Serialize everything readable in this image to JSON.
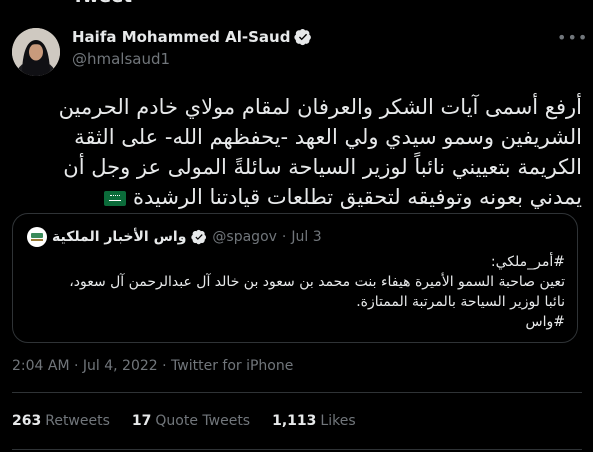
{
  "header": {
    "title": "Tweet"
  },
  "author": {
    "name": "Haifa Mohammed Al-Saud",
    "handle": "@hmalsaud1",
    "verified": true
  },
  "tweet": {
    "text": "أرفع أسمى آيات الشكر والعرفان لمقام مولاي خادم الحرمين الشريفين وسمو سيدي ولي العهد -يحفظهم الله- على الثقة الكريمة بتعييني نائباً لوزير السياحة سائلةً المولى عز وجل أن يمدني بعونه وتوفيقه لتحقيق تطلعات قيادتنا الرشيدة"
  },
  "quoted": {
    "name": "واس الأخبار الملكية",
    "handle": "@spagov",
    "separator": "·",
    "date": "Jul 3",
    "lines": [
      "#أمر_ملكي:",
      "تعين صاحبة السمو الأميرة هيفاء بنت محمد بن سعود بن خالد آل عبدالرحمن آل سعود،",
      "نائبا لوزير السياحة بالمرتبة الممتازة.",
      "#واس"
    ]
  },
  "meta": {
    "text": "2:04 AM · Jul 4, 2022 · Twitter for iPhone"
  },
  "stats": {
    "retweets_count": "263",
    "retweets_label": "Retweets",
    "quotes_count": "17",
    "quotes_label": "Quote Tweets",
    "likes_count": "1,113",
    "likes_label": "Likes"
  },
  "colors": {
    "background": "#000000",
    "text": "#e7e9ea",
    "muted": "#71767b",
    "border": "#2f3336",
    "verified": "#e7e9ea"
  }
}
